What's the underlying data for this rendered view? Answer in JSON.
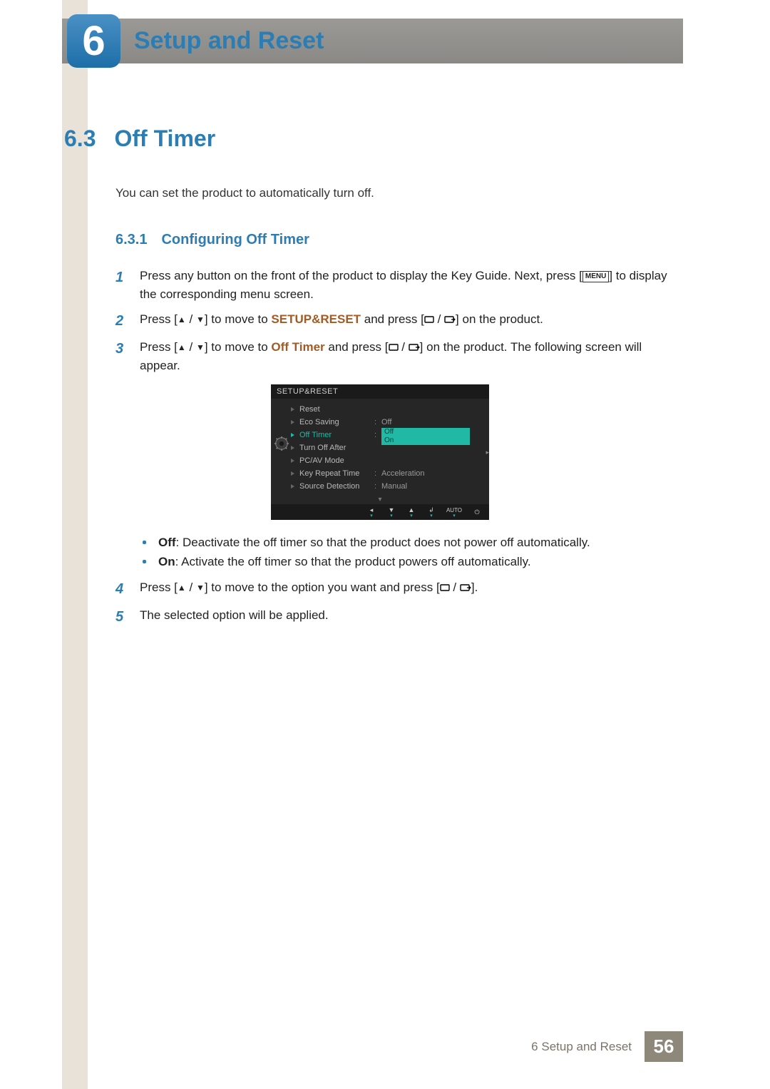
{
  "chapter": {
    "number": "6",
    "title": "Setup and Reset"
  },
  "section": {
    "number": "6.3",
    "title": "Off Timer",
    "intro": "You can set the product to automatically turn off."
  },
  "subsection": {
    "number": "6.3.1",
    "title": "Configuring Off Timer"
  },
  "steps": {
    "s1_a": "Press any button on the front of the product to display the Key Guide. Next, press [",
    "s1_menu": "MENU",
    "s1_b": "] to display the corresponding menu screen.",
    "s2_a": "Press [",
    "s2_b": "] to move to ",
    "s2_target": "SETUP&RESET",
    "s2_c": " and press [",
    "s2_d": "] on the product.",
    "s3_a": "Press [",
    "s3_b": "] to move to ",
    "s3_target": "Off Timer",
    "s3_c": " and press [",
    "s3_d": "] on the product. The following screen will appear.",
    "s4_a": "Press [",
    "s4_b": "] to move to the option you want and press [",
    "s4_c": "].",
    "s5": "The selected option will be applied."
  },
  "bullets": {
    "off_term": "Off",
    "off_text": ": Deactivate the off timer so that the product does not power off automatically.",
    "on_term": "On",
    "on_text": ": Activate the off timer so that the product powers off automatically."
  },
  "osd": {
    "title": "SETUP&RESET",
    "rows": [
      {
        "label": "Reset",
        "value": ""
      },
      {
        "label": "Eco Saving",
        "value": "Off"
      },
      {
        "label": "Off Timer",
        "value": "",
        "selected": true
      },
      {
        "label": "Turn Off After",
        "value": ""
      },
      {
        "label": "PC/AV Mode",
        "value": ""
      },
      {
        "label": "Key Repeat Time",
        "value": "Acceleration"
      },
      {
        "label": "Source Detection",
        "value": "Manual"
      }
    ],
    "options": [
      "Off",
      "On"
    ],
    "footer_auto": "AUTO"
  },
  "footer": {
    "label": "6 Setup and Reset",
    "page": "56"
  }
}
